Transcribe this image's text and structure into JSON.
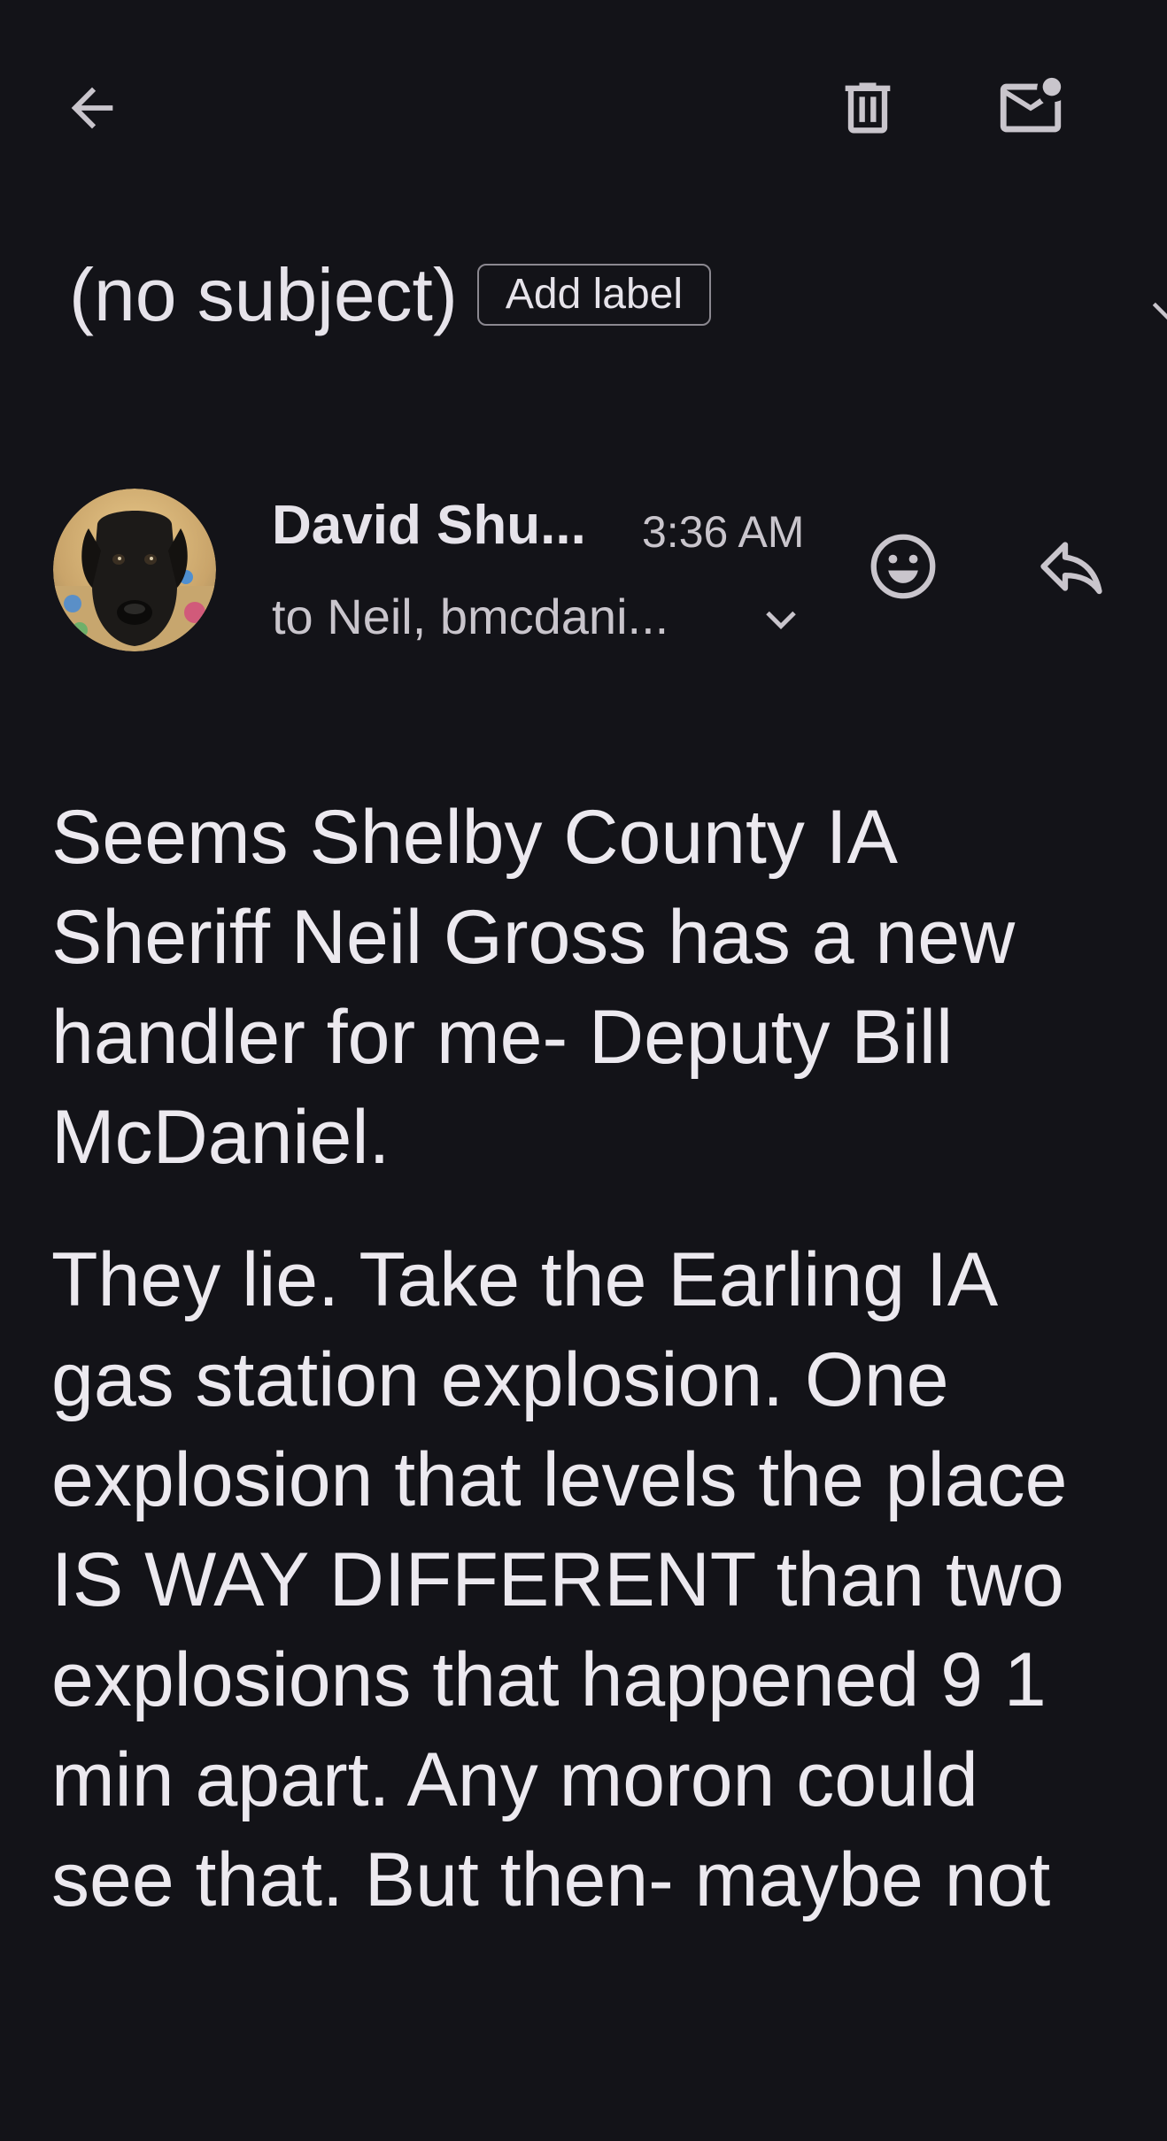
{
  "toolbar": {
    "back_icon": "arrow-left-icon",
    "delete_icon": "trash-icon",
    "unread_icon": "mark-unread-icon"
  },
  "email": {
    "subject": "(no subject)",
    "add_label": "Add label",
    "sender_name": "David Shu...",
    "time": "3:36 AM",
    "recipients": "to Neil, bmcdani...",
    "body_paragraph_1": [
      "Seems Shelby County IA",
      "Sheriff Neil Gross has a new",
      "handler for me- Deputy Bill",
      "McDaniel."
    ],
    "body_paragraph_2": [
      "They lie. Take the Earling IA",
      "gas station explosion. One",
      "explosion that levels the place",
      "IS WAY DIFFERENT than two",
      "explosions that happened 9 1",
      "min apart. Any moron could",
      "see that. But then- maybe not"
    ]
  },
  "colors": {
    "background": "#131318",
    "text_primary": "#e6e3ea",
    "text_secondary": "#c9c5cc",
    "icon": "#c9c5cc"
  }
}
